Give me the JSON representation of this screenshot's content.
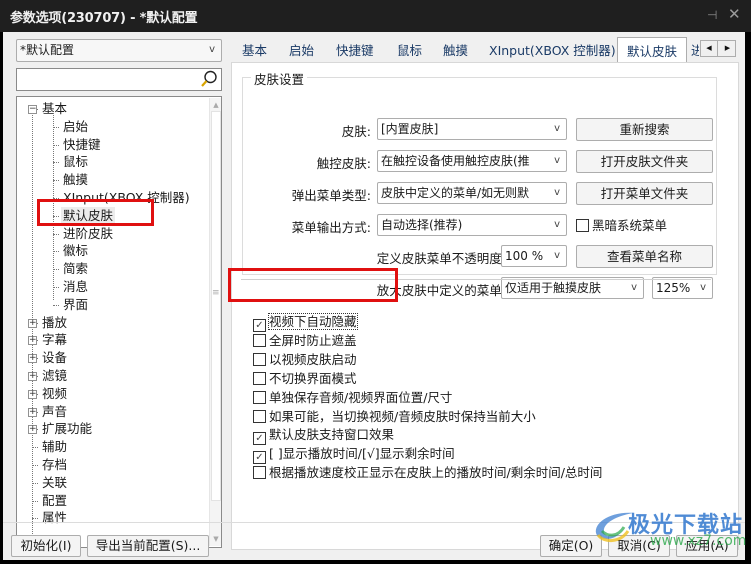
{
  "window": {
    "title": "参数选项(230707) - *默认配置",
    "pin_icon": "pin-icon",
    "close_icon": "close-icon"
  },
  "sidebar": {
    "profile_combo": {
      "value": "*默认配置",
      "arrow": "v"
    },
    "search": {
      "value": "",
      "placeholder": "",
      "icon": "search-icon"
    },
    "tree": [
      {
        "label": "基本",
        "level": 0,
        "expander": "minus",
        "selected": false
      },
      {
        "label": "启始",
        "level": 1
      },
      {
        "label": "快捷键",
        "level": 1
      },
      {
        "label": "鼠标",
        "level": 1
      },
      {
        "label": "触摸",
        "level": 1
      },
      {
        "label": "XInput(XBOX 控制器)",
        "level": 1
      },
      {
        "label": "默认皮肤",
        "level": 1,
        "selected": true
      },
      {
        "label": "进阶皮肤",
        "level": 1
      },
      {
        "label": "徽标",
        "level": 1
      },
      {
        "label": "简索",
        "level": 1
      },
      {
        "label": "消息",
        "level": 1
      },
      {
        "label": "界面",
        "level": 1
      },
      {
        "label": "播放",
        "level": 0,
        "expander": "plus"
      },
      {
        "label": "字幕",
        "level": 0,
        "expander": "plus"
      },
      {
        "label": "设备",
        "level": 0,
        "expander": "plus"
      },
      {
        "label": "滤镜",
        "level": 0,
        "expander": "plus"
      },
      {
        "label": "视频",
        "level": 0,
        "expander": "plus"
      },
      {
        "label": "声音",
        "level": 0,
        "expander": "plus"
      },
      {
        "label": "扩展功能",
        "level": 0,
        "expander": "plus"
      },
      {
        "label": "辅助",
        "level": 0
      },
      {
        "label": "存档",
        "level": 0
      },
      {
        "label": "关联",
        "level": 0
      },
      {
        "label": "配置",
        "level": 0
      },
      {
        "label": "属性",
        "level": 0
      }
    ]
  },
  "tabs": [
    {
      "label": "基本"
    },
    {
      "label": "启始"
    },
    {
      "label": "快捷键"
    },
    {
      "label": "鼠标"
    },
    {
      "label": "触摸"
    },
    {
      "label": "XInput(XBOX 控制器)"
    },
    {
      "label": "默认皮肤",
      "active": true
    },
    {
      "label": "进"
    }
  ],
  "tab_scroll": {
    "left": "◀",
    "right": "▶"
  },
  "skin_settings": {
    "group_title": "皮肤设置",
    "skin": {
      "label": "皮肤:",
      "value": "[内置皮肤]",
      "button": "重新搜索"
    },
    "touch_skin": {
      "label": "触控皮肤:",
      "value": "在触控设备使用触控皮肤(推",
      "button": "打开皮肤文件夹"
    },
    "popup_menu_type": {
      "label": "弹出菜单类型:",
      "value": "皮肤中定义的菜单/如无则默",
      "button": "打开菜单文件夹"
    },
    "menu_output": {
      "label": "菜单输出方式:",
      "value": "自动选择(推荐)",
      "checkbox_label": "黑暗系统菜单",
      "checkbox_checked": false
    },
    "menu_opacity": {
      "label": "定义皮肤菜单不透明度:",
      "value": "100 %",
      "button": "查看菜单名称"
    },
    "enlarge_menu": {
      "label": "放大皮肤中定义的菜单:",
      "value": "仅适用于触摸皮肤",
      "scale": "125%"
    },
    "arrow": "v"
  },
  "options": [
    {
      "label": "视频下自动隐藏",
      "checked": true,
      "focused": true
    },
    {
      "label": "全屏时防止遮盖",
      "checked": false
    },
    {
      "label": "以视频皮肤启动",
      "checked": false
    },
    {
      "label": "不切换界面模式",
      "checked": false
    },
    {
      "label": "单独保存音频/视频界面位置/尺寸",
      "checked": false
    },
    {
      "label": "如果可能，当切换视频/音频皮肤时保持当前大小",
      "checked": false
    },
    {
      "label": "默认皮肤支持窗口效果",
      "checked": true
    },
    {
      "label": "[ ]显示播放时间/[√]显示剩余时间",
      "checked": true
    },
    {
      "label": "根据播放速度校正显示在皮肤上的播放时间/剩余时间/总时间",
      "checked": false
    }
  ],
  "footer": {
    "init_button": "初始化(I)",
    "export_button": "导出当前配置(S)...",
    "ok_button": "确定(O)",
    "cancel_button": "取消(C)",
    "apply_button": "应用(A)"
  },
  "watermark": {
    "text": "极光下载站",
    "url": "www.xz7.com"
  },
  "colors": {
    "highlight_box": "#e01010",
    "title_bar": "#1f1f1f",
    "tab_text": "#1a3a66"
  }
}
